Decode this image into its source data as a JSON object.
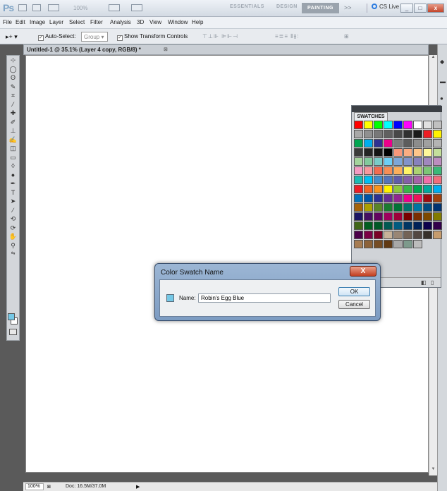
{
  "app": {
    "logo": "Ps",
    "zoom_display": "100%",
    "workspaces": [
      "ESSENTIALS",
      "DESIGN"
    ],
    "active_workspace": "PAINTING",
    "more_workspaces": ">>",
    "cs_live": "CS Live"
  },
  "menu": [
    "File",
    "Edit",
    "Image",
    "Layer",
    "Select",
    "Filter",
    "Analysis",
    "3D",
    "View",
    "Window",
    "Help"
  ],
  "options": {
    "auto_select_label": "Auto-Select:",
    "auto_select_value": "Group",
    "transform_label": "Show Transform Controls"
  },
  "document": {
    "tab_title": "Untitled-1 @ 35.1% (Layer 4 copy, RGB/8) *"
  },
  "status": {
    "zoom": "100%",
    "doc_size": "Doc: 16.5M/37.0M"
  },
  "swatches_panel": {
    "title": "SWATCHES",
    "colors": [
      "#ff0000",
      "#ffff00",
      "#00ff00",
      "#00ffff",
      "#0000ff",
      "#ff00ff",
      "#ffffff",
      "#e0e0e0",
      "#c0c0c0",
      "#a8a8a8",
      "#909090",
      "#787878",
      "#606060",
      "#484848",
      "#303030",
      "#1a1a1a",
      "#ed1c24",
      "#fff200",
      "#00a651",
      "#00aeef",
      "#2e3192",
      "#ec008c",
      "#7a7a7a",
      "#5c5c5c",
      "#8c8c8c",
      "#a0a0a0",
      "#b4b4b4",
      "#3a3a3a",
      "#242424",
      "#141414",
      "#000000",
      "#f7977a",
      "#fbad82",
      "#fdc68a",
      "#fff79a",
      "#c4df9b",
      "#a3d39c",
      "#82ca9c",
      "#7accc8",
      "#6dcff6",
      "#7da7d9",
      "#8393ca",
      "#8781bd",
      "#a187be",
      "#bc8dbf",
      "#f49ac2",
      "#f6989d",
      "#f26c4f",
      "#f68e55",
      "#fbaf5c",
      "#fff467",
      "#acd372",
      "#7cc576",
      "#3bb878",
      "#1abbb4",
      "#00bff3",
      "#438ccb",
      "#5574b9",
      "#605ca9",
      "#855fa8",
      "#a763a8",
      "#f06ea9",
      "#f26d7d",
      "#ed1c24",
      "#f26522",
      "#f7941d",
      "#fff200",
      "#8dc73f",
      "#39b54a",
      "#00a651",
      "#00a99d",
      "#00aeef",
      "#0072bc",
      "#0054a6",
      "#2e3192",
      "#662d91",
      "#92278f",
      "#ec008c",
      "#ed145b",
      "#9e0b0f",
      "#a0410d",
      "#a36209",
      "#aba000",
      "#598527",
      "#1a7b30",
      "#007236",
      "#00746b",
      "#0076a3",
      "#004b80",
      "#003471",
      "#1b1464",
      "#440e62",
      "#630460",
      "#9e005d",
      "#9e0039",
      "#790000",
      "#7b2e00",
      "#7d4900",
      "#827b00",
      "#406618",
      "#005e20",
      "#005826",
      "#005952",
      "#005b7f",
      "#003663",
      "#002157",
      "#0d004c",
      "#32004b",
      "#4b0049",
      "#7b0046",
      "#7a0026",
      "#c7b299",
      "#998675",
      "#736357",
      "#534741",
      "#37302a",
      "#c69c6d",
      "#a67c52",
      "#8c6239",
      "#754c24",
      "#603913",
      "#a8a8a8",
      "#7d9a8c",
      "#bcbcbc"
    ]
  },
  "dialog": {
    "title": "Color Swatch Name",
    "close_label": "X",
    "name_label": "Name:",
    "name_value": "Robin's Egg Blue",
    "ok_label": "OK",
    "cancel_label": "Cancel",
    "swatch_color": "#75c8e6"
  }
}
